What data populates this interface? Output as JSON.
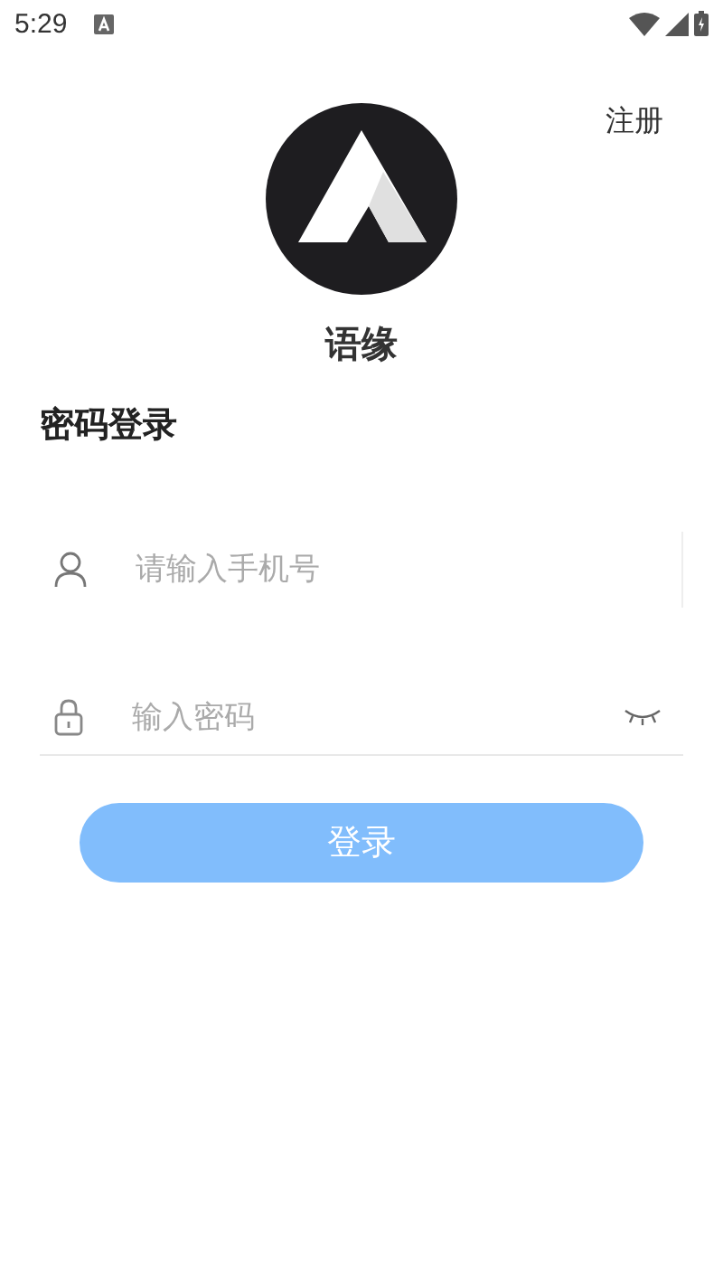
{
  "status_bar": {
    "time": "5:29"
  },
  "register_link": "注册",
  "app_name": "语缘",
  "login_title": "密码登录",
  "phone_field": {
    "placeholder": "请输入手机号"
  },
  "password_field": {
    "placeholder": "输入密码",
    "password_visible": false
  },
  "login_button": {
    "label": "登录",
    "disabled": true
  }
}
